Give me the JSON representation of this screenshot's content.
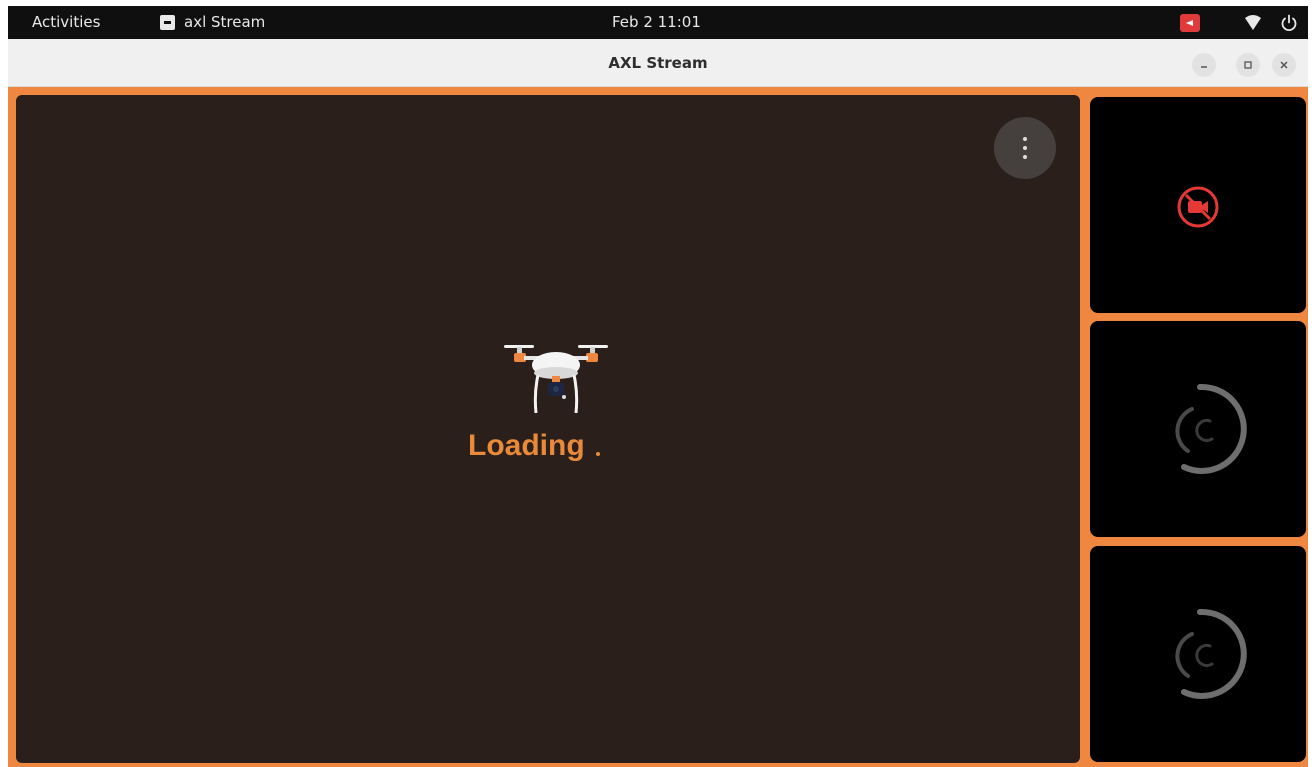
{
  "topbar": {
    "activities_label": "Activities",
    "app_label": "axl Stream",
    "clock": "Feb 2  11:01",
    "icons": [
      "app-notification-icon",
      "wifi-icon",
      "power-icon"
    ]
  },
  "window": {
    "title": "AXL Stream",
    "controls": [
      "minimize-icon",
      "maximize-icon",
      "close-icon"
    ]
  },
  "main_view": {
    "status_text": "Loading",
    "menu_icon": "more-vertical-icon",
    "placeholder_icon": "drone-icon"
  },
  "side_tiles": [
    {
      "state": "no-video",
      "icon": "video-off-icon"
    },
    {
      "state": "loading",
      "icon": "spinner-icon"
    },
    {
      "state": "loading",
      "icon": "spinner-icon"
    }
  ],
  "colors": {
    "accent": "#f08740",
    "main_bg": "#2a1f1b",
    "tile_bg": "#000000",
    "loading_text": "#e98a3b",
    "no_video_red": "#e53935"
  }
}
